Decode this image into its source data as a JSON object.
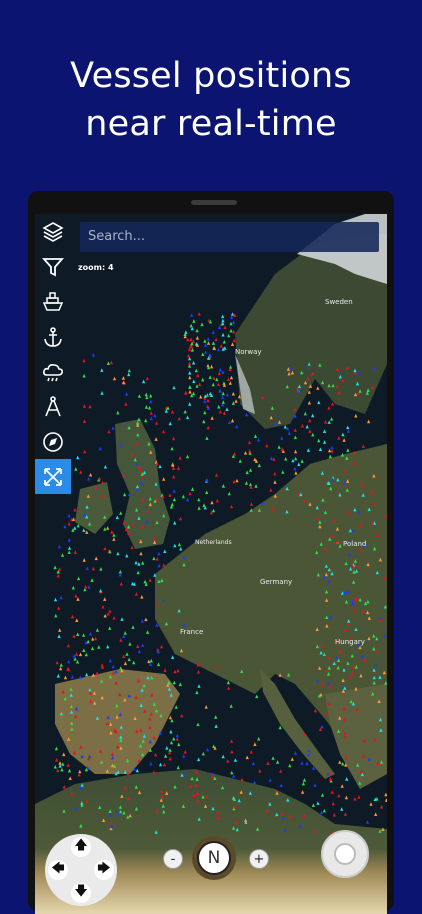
{
  "headline": {
    "line1": "Vessel positions",
    "line2": "near real-time"
  },
  "search": {
    "placeholder": "Search..."
  },
  "zoom_label": "zoom: 4",
  "map_labels": {
    "sweden": "Sweden",
    "norway": "Norway",
    "poland": "Poland",
    "germany": "Germany",
    "france": "France",
    "hungary": "Hungary",
    "netherlands": "Netherlands"
  },
  "toolbar": {
    "items": [
      {
        "icon": "layers-icon"
      },
      {
        "icon": "filter-icon"
      },
      {
        "icon": "ship-icon"
      },
      {
        "icon": "anchor-icon"
      },
      {
        "icon": "weather-icon"
      },
      {
        "icon": "measure-icon"
      },
      {
        "icon": "navigation-icon"
      },
      {
        "icon": "fullscreen-icon",
        "active": true
      }
    ]
  },
  "controls": {
    "zoom_out": "-",
    "zoom_in": "+",
    "compass": "N",
    "up": "🡅",
    "down": "🡇",
    "left": "🡄",
    "right": "🡆"
  },
  "colors": {
    "background": "#0b1470",
    "active_tool": "#2a8be8",
    "vessel_red": "#e8121e",
    "vessel_green": "#2fe04a",
    "vessel_cyan": "#22e0e8",
    "vessel_blue": "#1a3cff",
    "vessel_orange": "#ff9a3a"
  }
}
